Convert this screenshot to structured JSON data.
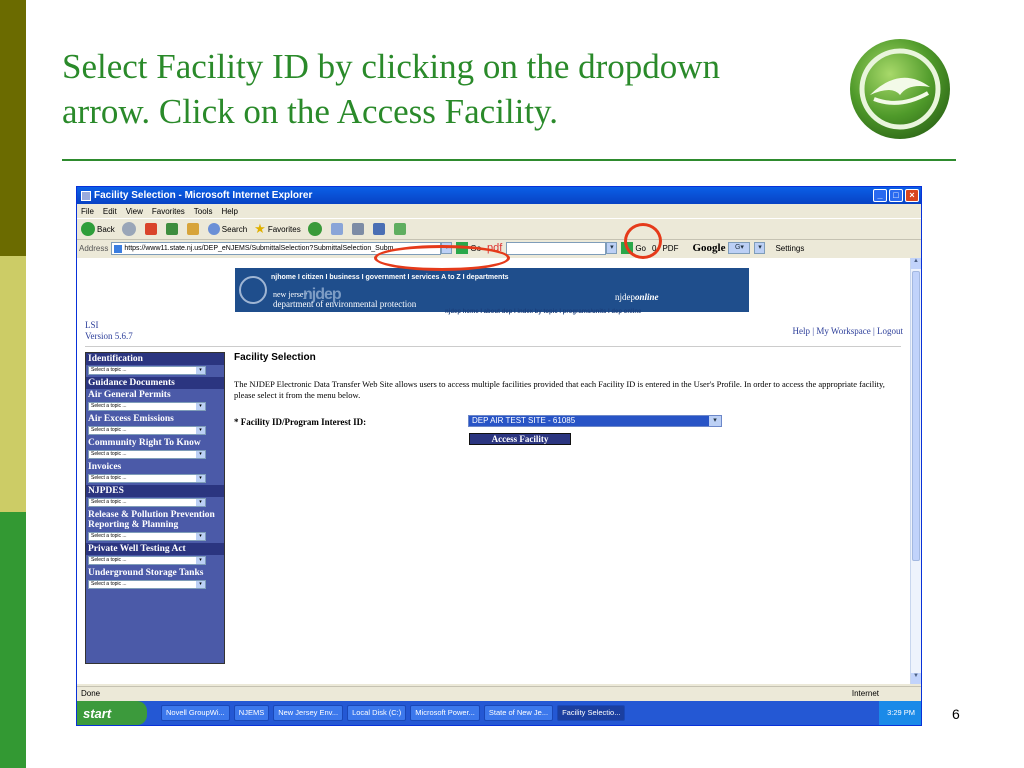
{
  "slide": {
    "title_line1": "Select Facility ID by clicking on the dropdown",
    "title_line2": "arrow. Click on the Access Facility.",
    "page_number": "6"
  },
  "browser": {
    "window_title": "Facility Selection - Microsoft Internet Explorer",
    "menu": [
      "File",
      "Edit",
      "View",
      "Favorites",
      "Tools",
      "Help"
    ],
    "toolbar": {
      "back": "Back",
      "search": "Search",
      "favorites": "Favorites"
    },
    "address_label": "Address",
    "address_value": "https://www11.state.nj.us/DEP_eNJEMS/SubmittalSelection?SubmittalSelection_Subm",
    "go_label": "Go",
    "pdf_label": "pdf",
    "go2_label": "Go",
    "count_label": "0",
    "pdf2_label": "PDF",
    "google_label": "Google",
    "settings_label": "Settings"
  },
  "page": {
    "banner_links": "njhome  I  citizen  I  business  I  government  I  services A to Z  I  departments",
    "nj_small": "new jersey",
    "nj_big": "njdep",
    "dept_name": "department of environmental protection",
    "njdep_online_prefix": "njdep",
    "njdep_online_suffix": "online",
    "njdep_links": "njdep home  I  about dep  I  index by topic  I  programs/units  I  dep online",
    "lsi": "LSI",
    "version": "Version 5.6.7",
    "help_links": "Help | My Workspace | Logout",
    "sidebar": [
      {
        "heading": "Identification",
        "select": "Select a topic ..."
      },
      {
        "heading": "Guidance Documents",
        "sub": "Air General Permits",
        "select": "Select a topic ..."
      },
      {
        "heading": "Air Excess Emissions",
        "select": "Select a topic ..."
      },
      {
        "heading": "Community Right To Know",
        "select": "Select a topic ..."
      },
      {
        "heading": "Invoices",
        "select": "Select a topic ..."
      },
      {
        "heading": "NJPDES",
        "select": "Select a topic ..."
      },
      {
        "heading": "Release & Pollution Prevention Reporting & Planning",
        "select": "Select a topic ..."
      },
      {
        "heading": "Private Well Testing Act",
        "select": "Select a topic ..."
      },
      {
        "heading": "Underground Storage Tanks",
        "select": "Select a topic ..."
      }
    ],
    "form_title": "Facility Selection",
    "description": "The NJDEP Electronic Data Transfer Web Site allows users to access multiple facilities provided that each Facility ID is entered in the User's Profile. In order to access the appropriate facility, please select it from the menu below.",
    "field_label": "* Facility ID/Program Interest ID:",
    "selected_facility": "DEP AIR TEST SITE - 61085",
    "access_button": "Access Facility"
  },
  "status": {
    "left": "Done",
    "zone": "Internet"
  },
  "taskbar": {
    "start": "start",
    "tasks": [
      "Novell GroupWi...",
      "NJEMS",
      "New Jersey Env...",
      "Local Disk (C:)",
      "Microsoft Power...",
      "State of New Je...",
      "Facility Selectio..."
    ],
    "clock": "3:29 PM"
  }
}
